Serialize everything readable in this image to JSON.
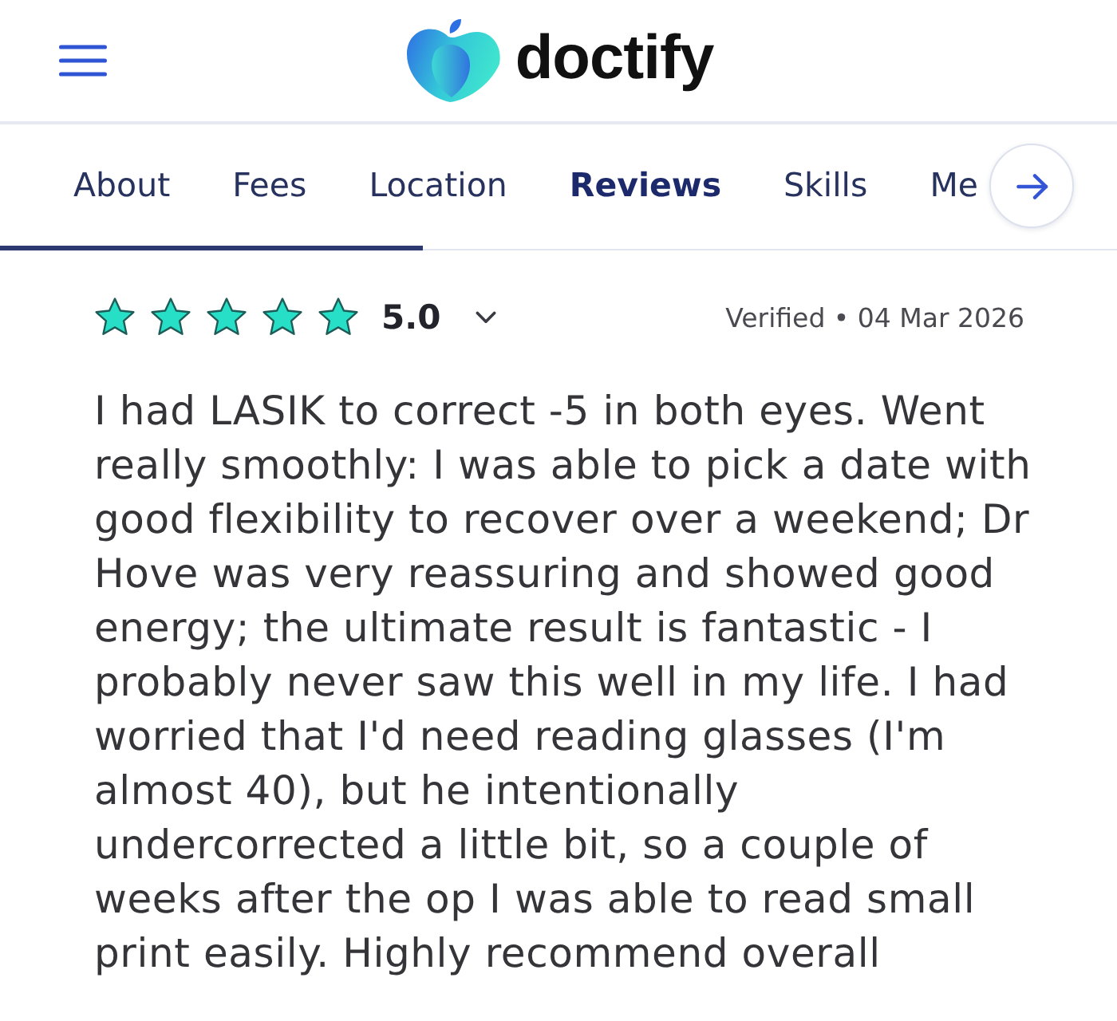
{
  "header": {
    "logo_text": "doctify"
  },
  "tabs": [
    {
      "label": "About",
      "selected": false
    },
    {
      "label": "Fees",
      "selected": false
    },
    {
      "label": "Location",
      "selected": false
    },
    {
      "label": "Reviews",
      "selected": true
    },
    {
      "label": "Skills",
      "selected": false
    },
    {
      "label": "Me",
      "selected": false
    }
  ],
  "review": {
    "stars": 5,
    "rating": "5.0",
    "meta": "Verified • 04 Mar 2026",
    "text": "I had LASIK to correct -5 in both eyes. Went really smoothly: I was able to pick a date with good flexibility to recover over a weekend; Dr Hove was very reassuring and showed good energy; the ultimate result is fantastic - I probably never saw this well in my life. I had worried that I'd need reading glasses (I'm almost 40), but he intentionally undercorrected a little bit, so a couple of weeks after the op I was able to read small print easily. Highly recommend overall"
  }
}
